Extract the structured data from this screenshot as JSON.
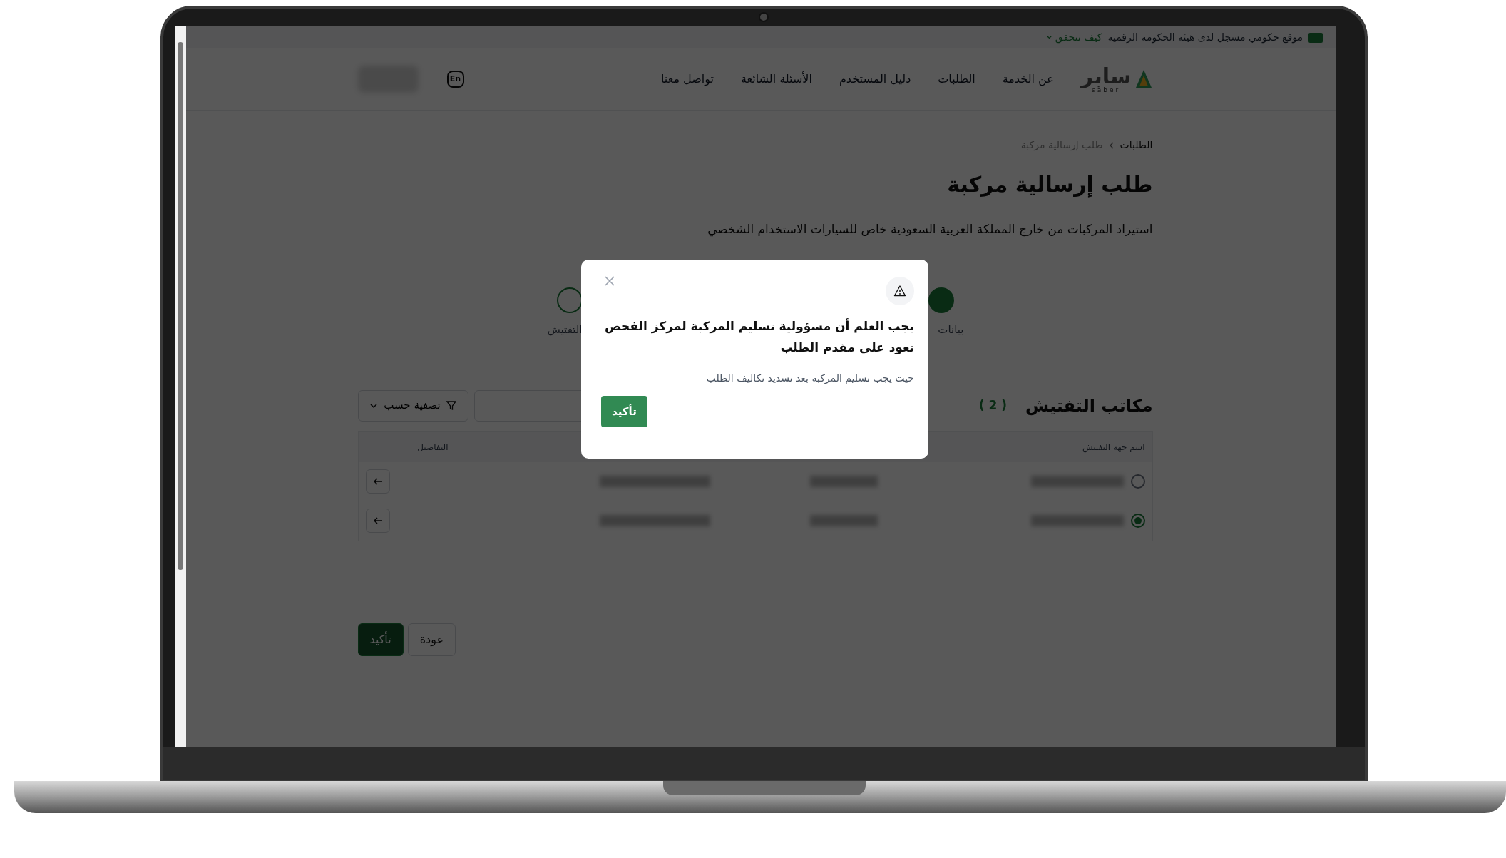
{
  "gov_banner": {
    "text": "موقع حكومي مسجل لدى هيئة الحكومة الرقمية",
    "link": "كيف تتحقق"
  },
  "header": {
    "logo": {
      "name": "سابر",
      "latin": "saber"
    },
    "nav": [
      "عن الخدمة",
      "الطلبات",
      "دليل المستخدم",
      "الأسئلة الشائعة",
      "تواصل معنا"
    ],
    "language": "En"
  },
  "breadcrumb": [
    {
      "label": "الطلبات",
      "current": false
    },
    {
      "label": "طلب إرسالية مركبة",
      "current": true
    }
  ],
  "title": "طلب إرسالية مركبة",
  "subtitle": "استيراد المركبات من خارج المملكة العربية السعودية خاص للسيارات الاستخدام الشخصي",
  "stepper": [
    {
      "label": "بيانات",
      "done": true
    },
    {
      "label": "التفتيش",
      "done": false
    }
  ],
  "section": {
    "title": "مكاتب التفتيش",
    "count": "( 2 )",
    "filter": "تصفية حسب",
    "columns": [
      "اسم جهة التفتيش",
      "التفاصيل"
    ],
    "rows": [
      {
        "selected": false
      },
      {
        "selected": true
      }
    ]
  },
  "buttons": [
    {
      "label": "عودة",
      "kind": "secondary"
    },
    {
      "label": "تأكيد",
      "kind": "primary"
    }
  ],
  "dialog": {
    "heading": "يجب العلم أن مسؤولية تسليم المركبة لمركز الفحص تعود على مقدم الطلب",
    "body": "حيث يجب تسليم المركبة بعد تسديد تكاليف الطلب",
    "confirm": "تأكيد"
  }
}
